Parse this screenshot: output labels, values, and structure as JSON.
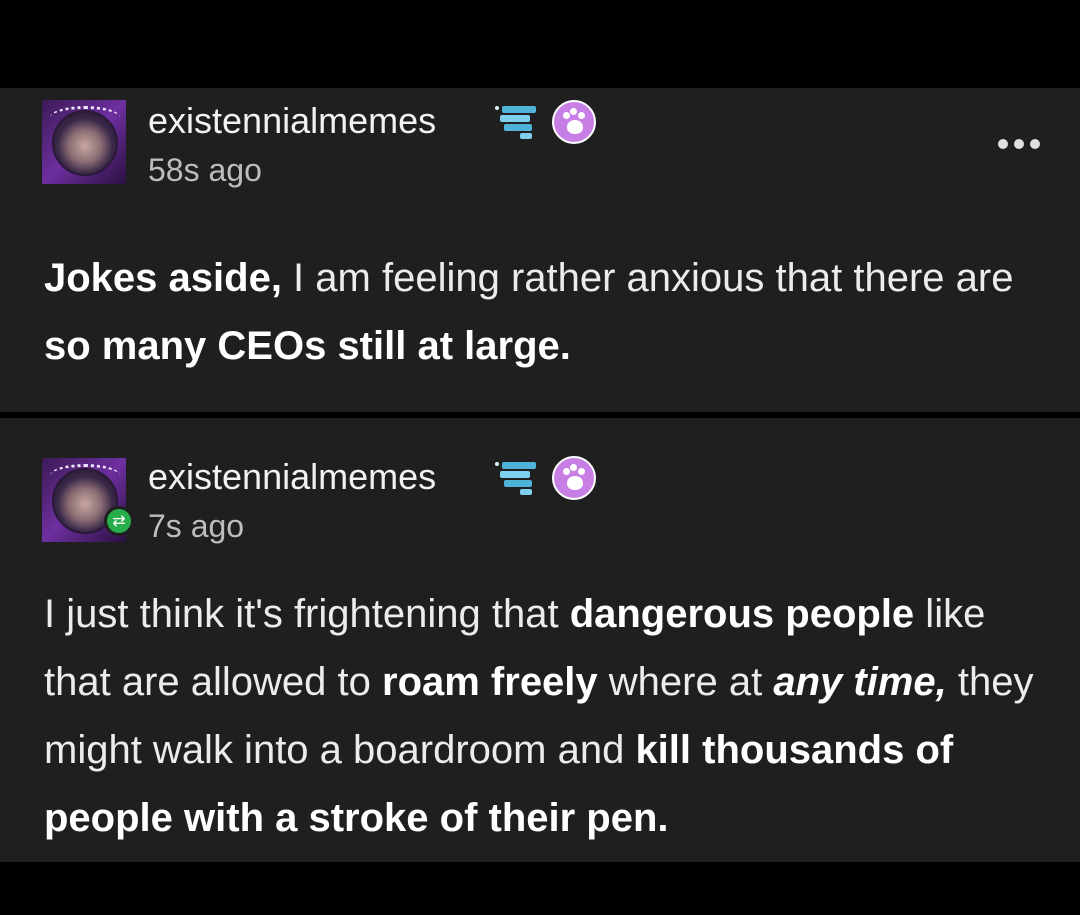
{
  "posts": [
    {
      "username": "existennialmemes",
      "timestamp": "58s ago",
      "text_segments": [
        {
          "text": "Jokes aside,",
          "style": "bold"
        },
        {
          "text": " I am feeling rather anxious that there are ",
          "style": "normal"
        },
        {
          "text": "so many CEOs still at large.",
          "style": "bold"
        }
      ],
      "more_icon": "ellipsis-icon"
    },
    {
      "username": "existennialmemes",
      "timestamp": "7s ago",
      "reblog_icon": "reblog-icon",
      "text_segments": [
        {
          "text": "I just think it's frightening that ",
          "style": "normal"
        },
        {
          "text": "dangerous people",
          "style": "bold"
        },
        {
          "text": " like that are allowed to ",
          "style": "normal"
        },
        {
          "text": "roam freely",
          "style": "bold"
        },
        {
          "text": " where at ",
          "style": "normal"
        },
        {
          "text": "any time,",
          "style": "bold-italic"
        },
        {
          "text": " they might walk into a boardroom and ",
          "style": "normal"
        },
        {
          "text": "kill thousands of people with a stroke of their pen.",
          "style": "bold"
        }
      ]
    }
  ],
  "colors": {
    "page_background": "#000000",
    "post_background": "#1f1f1f",
    "badge_paw": "#c77fe6",
    "badge_chat": "#4fb3d9",
    "reblog_badge": "#27ae4a"
  }
}
